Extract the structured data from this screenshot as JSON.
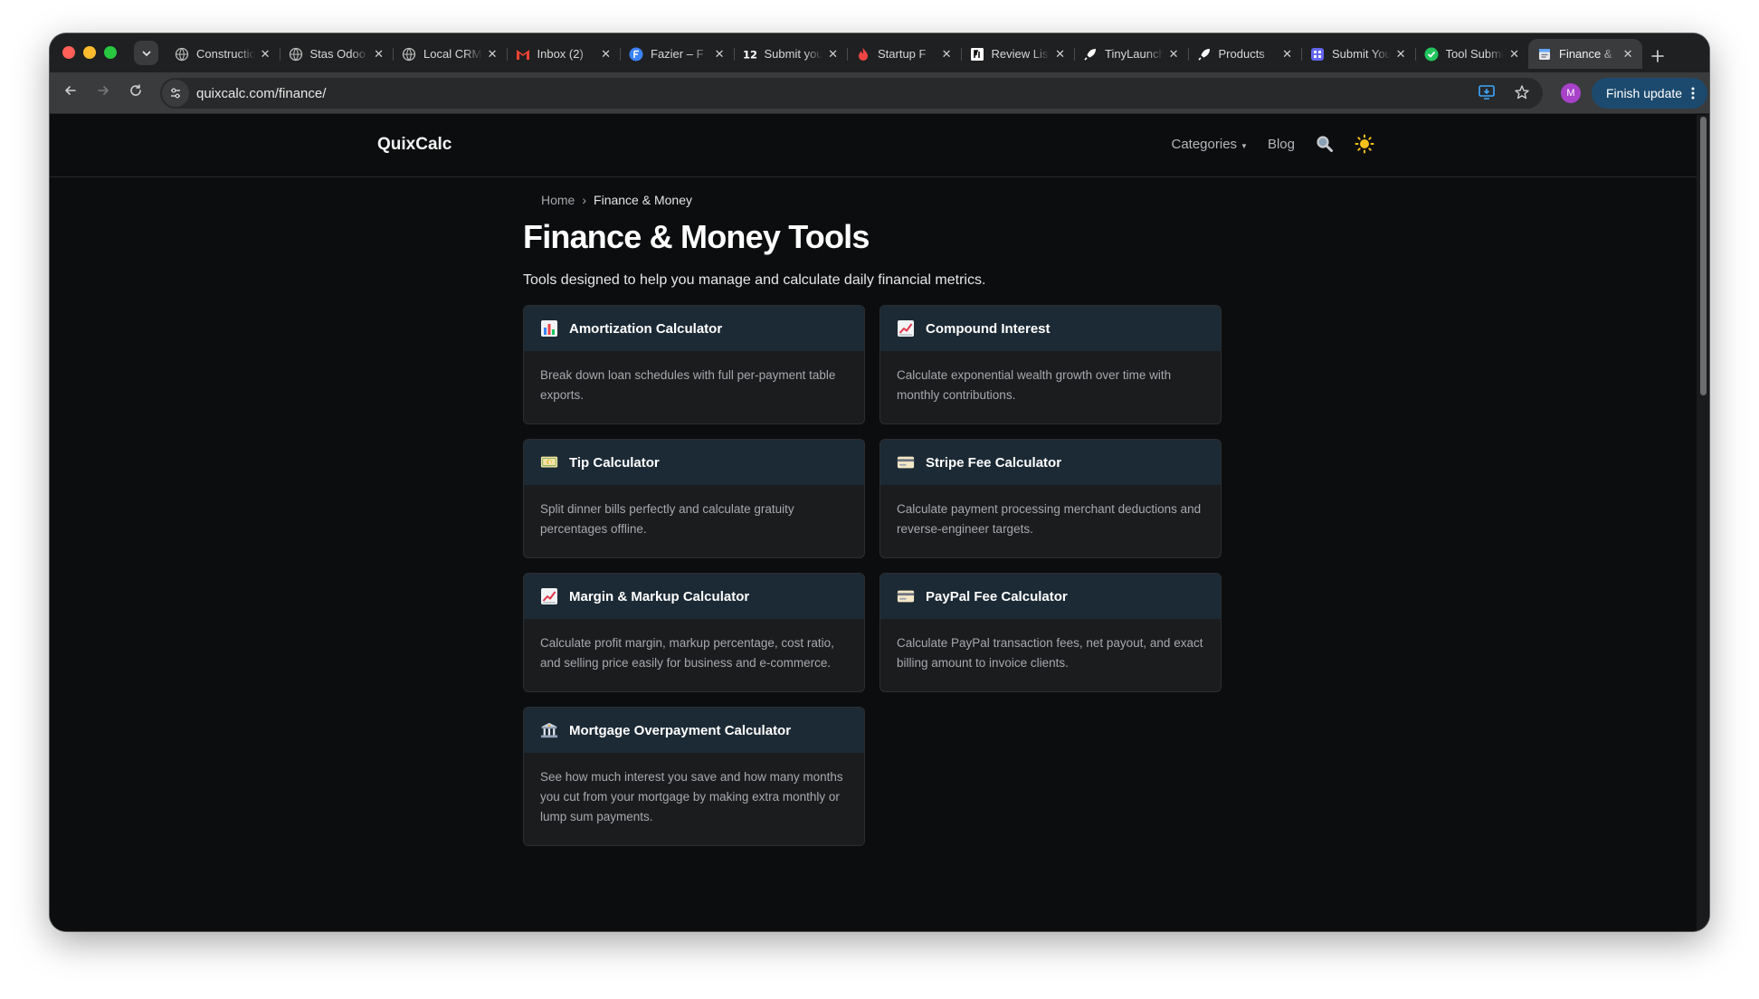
{
  "browser": {
    "tabs": [
      {
        "title": "Construction",
        "icon": "globe-icon",
        "color": "#bdbdbd",
        "active": false
      },
      {
        "title": "Stas Odoo",
        "icon": "globe-icon",
        "color": "#bdbdbd",
        "active": false
      },
      {
        "title": "Local CRM",
        "icon": "globe-icon",
        "color": "#bdbdbd",
        "active": false
      },
      {
        "title": "Inbox (2)",
        "icon": "gmail-icon",
        "color": "#ea4335",
        "active": false
      },
      {
        "title": "Fazier – F",
        "icon": "fazier-icon",
        "color": "#3b82f6",
        "active": false
      },
      {
        "title": "Submit your",
        "icon": "twelve-icon",
        "color": "#ffffff",
        "active": false
      },
      {
        "title": "Startup F",
        "icon": "flame-icon",
        "color": "#ef4444",
        "active": false
      },
      {
        "title": "Review List",
        "icon": "review-icon",
        "color": "#ffffff",
        "active": false
      },
      {
        "title": "TinyLaunch",
        "icon": "rocket-icon",
        "color": "#ffffff",
        "active": false
      },
      {
        "title": "Products",
        "icon": "rocket-icon",
        "color": "#ffffff",
        "active": false
      },
      {
        "title": "Submit Your",
        "icon": "grid-icon",
        "color": "#6366f1",
        "active": false
      },
      {
        "title": "Tool Submit",
        "icon": "check-icon",
        "color": "#22c55e",
        "active": false
      },
      {
        "title": "Finance &",
        "icon": "page-icon",
        "color": "#60a5fa",
        "active": true
      }
    ],
    "url": "quixcalc.com/finance/",
    "profile_initial": "M",
    "finish_update_label": "Finish update"
  },
  "site": {
    "brand": "QuixCalc",
    "nav": {
      "categories_label": "Categories",
      "blog_label": "Blog"
    }
  },
  "page": {
    "breadcrumb": {
      "home": "Home",
      "separator": "›",
      "current": "Finance & Money"
    },
    "title": "Finance & Money Tools",
    "description": "Tools designed to help you manage and calculate daily financial metrics."
  },
  "tools": [
    {
      "title": "Amortization Calculator",
      "icon": "bar-chart-icon",
      "description": "Break down loan schedules with full per-payment table exports."
    },
    {
      "title": "Compound Interest",
      "icon": "trend-up-icon",
      "description": "Calculate exponential wealth growth over time with monthly contributions."
    },
    {
      "title": "Tip Calculator",
      "icon": "money-icon",
      "description": "Split dinner bills perfectly and calculate gratuity percentages offline."
    },
    {
      "title": "Stripe Fee Calculator",
      "icon": "credit-card-icon",
      "description": "Calculate payment processing merchant deductions and reverse-engineer targets."
    },
    {
      "title": "Margin & Markup Calculator",
      "icon": "trend-up-icon",
      "description": "Calculate profit margin, markup percentage, cost ratio, and selling price easily for business and e-commerce."
    },
    {
      "title": "PayPal Fee Calculator",
      "icon": "credit-card-icon",
      "description": "Calculate PayPal transaction fees, net payout, and exact billing amount to invoice clients."
    },
    {
      "title": "Mortgage Overpayment Calculator",
      "icon": "bank-icon",
      "description": "See how much interest you save and how many months you cut from your mortgage by making extra monthly or lump sum payments."
    }
  ]
}
